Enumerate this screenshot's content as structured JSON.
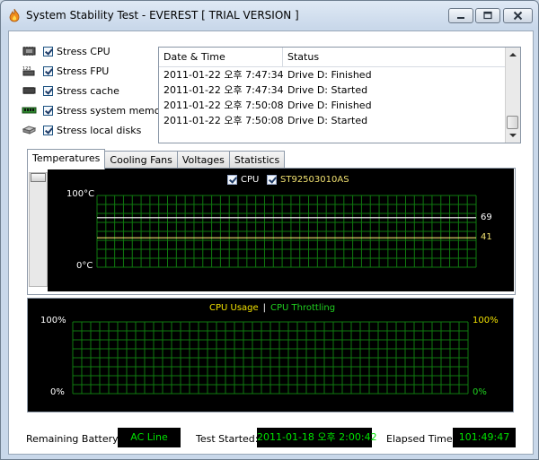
{
  "window": {
    "title": "System Stability Test - EVEREST  [ TRIAL VERSION ]"
  },
  "options": [
    {
      "label": "Stress CPU",
      "checked": true,
      "icon": "cpu-chip-icon"
    },
    {
      "label": "Stress FPU",
      "checked": true,
      "icon": "fpu-icon"
    },
    {
      "label": "Stress cache",
      "checked": true,
      "icon": "cache-chip-icon"
    },
    {
      "label": "Stress system memory",
      "checked": true,
      "icon": "memory-module-icon"
    },
    {
      "label": "Stress local disks",
      "checked": true,
      "icon": "disk-drive-icon"
    }
  ],
  "log": {
    "columns": [
      "Date & Time",
      "Status"
    ],
    "rows": [
      {
        "datetime": "2011-01-22 오후 7:47:34",
        "status": "Drive D: Finished"
      },
      {
        "datetime": "2011-01-22 오후 7:47:34",
        "status": "Drive D: Started"
      },
      {
        "datetime": "2011-01-22 오후 7:50:08",
        "status": "Drive D: Finished"
      },
      {
        "datetime": "2011-01-22 오후 7:50:08",
        "status": "Drive D: Started"
      }
    ]
  },
  "tabs": [
    {
      "label": "Temperatures",
      "active": true
    },
    {
      "label": "Cooling Fans",
      "active": false
    },
    {
      "label": "Voltages",
      "active": false
    },
    {
      "label": "Statistics",
      "active": false
    }
  ],
  "temperature_chart": {
    "legend": [
      {
        "label": "CPU",
        "color": "#ffffff",
        "checked": true
      },
      {
        "label": "ST92503010AS",
        "color": "#f0e070",
        "checked": true
      }
    ],
    "y_max_label": "100°C",
    "y_min_label": "0°C",
    "readouts": [
      {
        "value": "69",
        "color": "#ffffff"
      },
      {
        "value": "41",
        "color": "#f0e070"
      }
    ]
  },
  "usage_chart": {
    "legend_usage": "CPU Usage",
    "legend_sep": "|",
    "legend_throttling": "CPU Throttling",
    "usage_color": "#f0e000",
    "throttling_color": "#20d020",
    "y_max_left": "100%",
    "y_min_left": "0%",
    "y_max_right": "100%",
    "y_min_right": "0%"
  },
  "chart_data": [
    {
      "type": "line",
      "title": "",
      "ylim": [
        0,
        100
      ],
      "series": [
        {
          "name": "CPU",
          "values": [
            69
          ]
        },
        {
          "name": "ST92503010AS",
          "values": [
            41
          ]
        }
      ],
      "grid": true
    },
    {
      "type": "line",
      "title": "",
      "ylim": [
        0,
        100
      ],
      "series": [
        {
          "name": "CPU Usage",
          "values": []
        },
        {
          "name": "CPU Throttling",
          "values": []
        }
      ],
      "grid": true
    }
  ],
  "status": {
    "battery_label": "Remaining Battery:",
    "battery_value": "AC Line",
    "started_label": "Test Started:",
    "started_value": "2011-01-18 오후 2:00:42",
    "elapsed_label": "Elapsed Time:",
    "elapsed_value": "101:49:47"
  }
}
